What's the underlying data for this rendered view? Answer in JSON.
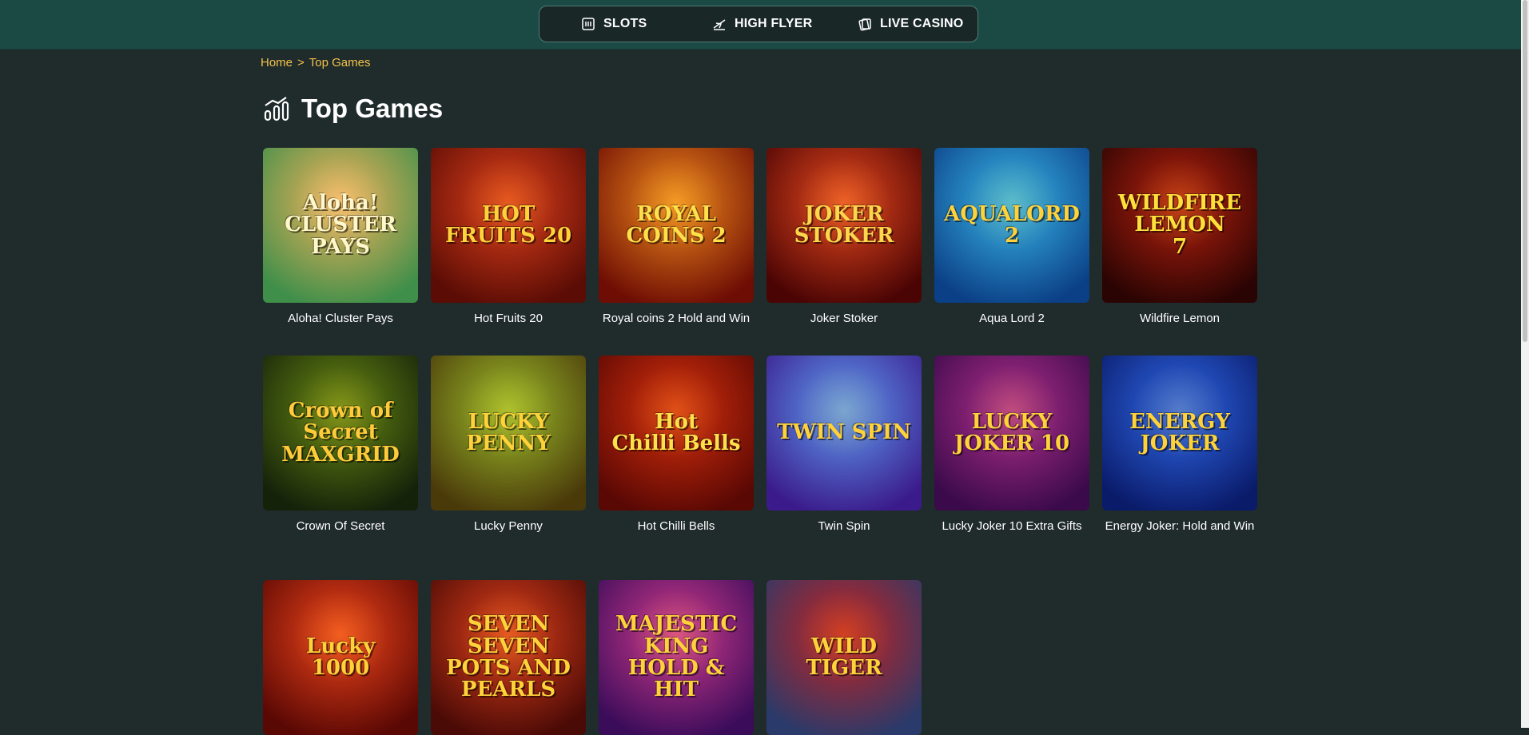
{
  "nav": {
    "items": [
      {
        "label": "SLOTS",
        "icon": "slot-machine-icon"
      },
      {
        "label": "HIGH FLYER",
        "icon": "airplane-icon"
      },
      {
        "label": "LIVE CASINO",
        "icon": "cards-icon"
      }
    ]
  },
  "breadcrumb": {
    "home": "Home",
    "separator": ">",
    "current": "Top Games"
  },
  "page": {
    "title": "Top Games",
    "icon": "chart-bars-icon"
  },
  "games": [
    {
      "name": "Aloha! Cluster Pays",
      "art": "Aloha!\nCLUSTER PAYS",
      "bg": [
        "#f6b35a",
        "#3f8f4a"
      ],
      "fg": "#fff6c9"
    },
    {
      "name": "Hot Fruits 20",
      "art": "HOT\nFRUITS 20",
      "bg": [
        "#e0401b",
        "#5a0c05"
      ],
      "fg": "#ffd23a"
    },
    {
      "name": "Royal coins 2 Hold and Win",
      "art": "ROYAL\nCOINS 2",
      "bg": [
        "#f08a1c",
        "#6e0d04"
      ],
      "fg": "#ffdf4a"
    },
    {
      "name": "Joker Stoker",
      "art": "JOKER\nSTOKER",
      "bg": [
        "#e8481e",
        "#4a0404"
      ],
      "fg": "#ffd54a"
    },
    {
      "name": "Aqua Lord 2",
      "art": "AQUALORD\n2",
      "bg": [
        "#38b6e8",
        "#0b3f86"
      ],
      "fg": "#ffd23a"
    },
    {
      "name": "Wildfire Lemon",
      "art": "WILDFIRE LEMON\n7",
      "bg": [
        "#b8200e",
        "#2a0403"
      ],
      "fg": "#ffe03a"
    },
    {
      "name": "Crown Of Secret",
      "art": "Crown of Secret\nMAXGRID",
      "bg": [
        "#6a8a12",
        "#14220a"
      ],
      "fg": "#ffcb3a"
    },
    {
      "name": "Lucky Penny",
      "art": "LUCKY\nPENNY",
      "bg": [
        "#9cbc2a",
        "#4a3a0a"
      ],
      "fg": "#ffd23a"
    },
    {
      "name": "Hot Chilli Bells",
      "art": "Hot\nChilli Bells",
      "bg": [
        "#d8300c",
        "#5a0804"
      ],
      "fg": "#ffe04a"
    },
    {
      "name": "Twin Spin",
      "art": "TWIN SPIN",
      "bg": [
        "#5e9cf0",
        "#3b1b8c"
      ],
      "fg": "#ffd23a"
    },
    {
      "name": "Lucky Joker 10 Extra Gifts",
      "art": "LUCKY\nJOKER 10",
      "bg": [
        "#b02e8c",
        "#3a0a4a"
      ],
      "fg": "#ffd23a"
    },
    {
      "name": "Energy Joker: Hold and Win",
      "art": "ENERGY\nJOKER",
      "bg": [
        "#2f68e8",
        "#0a1b6a"
      ],
      "fg": "#ffd23a"
    },
    {
      "name": "",
      "art": "Lucky\n1000",
      "bg": [
        "#f0441a",
        "#5a0804"
      ],
      "fg": "#ffd23a"
    },
    {
      "name": "",
      "art": "SEVEN SEVEN\nPOTS AND PEARLS",
      "bg": [
        "#e0401b",
        "#4a0a06"
      ],
      "fg": "#ffd23a"
    },
    {
      "name": "",
      "art": "MAJESTIC KING\nHOLD & HIT",
      "bg": [
        "#d23a8c",
        "#3a0c5a"
      ],
      "fg": "#ffd23a"
    },
    {
      "name": "",
      "art": "WILD TIGER",
      "bg": [
        "#c8201e",
        "#2a3a6a"
      ],
      "fg": "#ffd23a"
    }
  ]
}
